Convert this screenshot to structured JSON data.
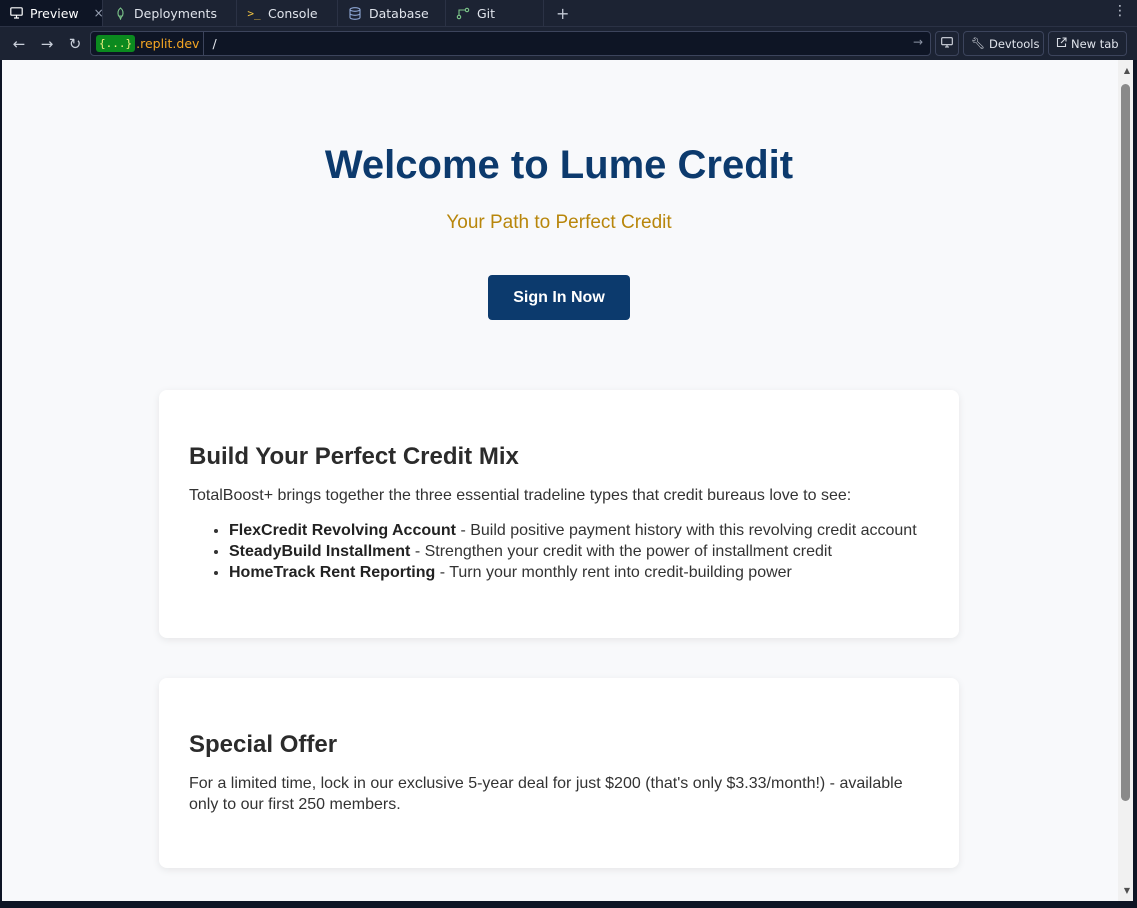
{
  "tabs": [
    {
      "label": "Preview",
      "icon": "monitor-icon",
      "active": true
    },
    {
      "label": "Deployments",
      "icon": "rocket-icon"
    },
    {
      "label": "Console",
      "icon": "terminal-icon"
    },
    {
      "label": "Database",
      "icon": "database-icon"
    },
    {
      "label": "Git",
      "icon": "git-icon"
    }
  ],
  "url": {
    "badge": "{...}",
    "domain": ".replit.dev",
    "path": "/"
  },
  "nav": {
    "devtools": "Devtools",
    "new_tab": "New tab"
  },
  "hero": {
    "title": "Welcome to Lume Credit",
    "subtitle": "Your Path to Perfect Credit",
    "cta": "Sign In Now"
  },
  "mix": {
    "heading": "Build Your Perfect Credit Mix",
    "intro": "TotalBoost+ brings together the three essential tradeline types that credit bureaus love to see:",
    "items": [
      {
        "name": "FlexCredit Revolving Account",
        "desc": " - Build positive payment history with this revolving credit account"
      },
      {
        "name": "SteadyBuild Installment",
        "desc": " - Strengthen your credit with the power of installment credit"
      },
      {
        "name": "HomeTrack Rent Reporting",
        "desc": " - Turn your monthly rent into credit-building power"
      }
    ]
  },
  "offer": {
    "heading": "Special Offer",
    "text": "For a limited time, lock in our exclusive 5-year deal for just $200 (that's only $3.33/month!) - available only to our first 250 members."
  },
  "colors": {
    "brand": "#0c3a6d",
    "accent": "#b8860b"
  }
}
